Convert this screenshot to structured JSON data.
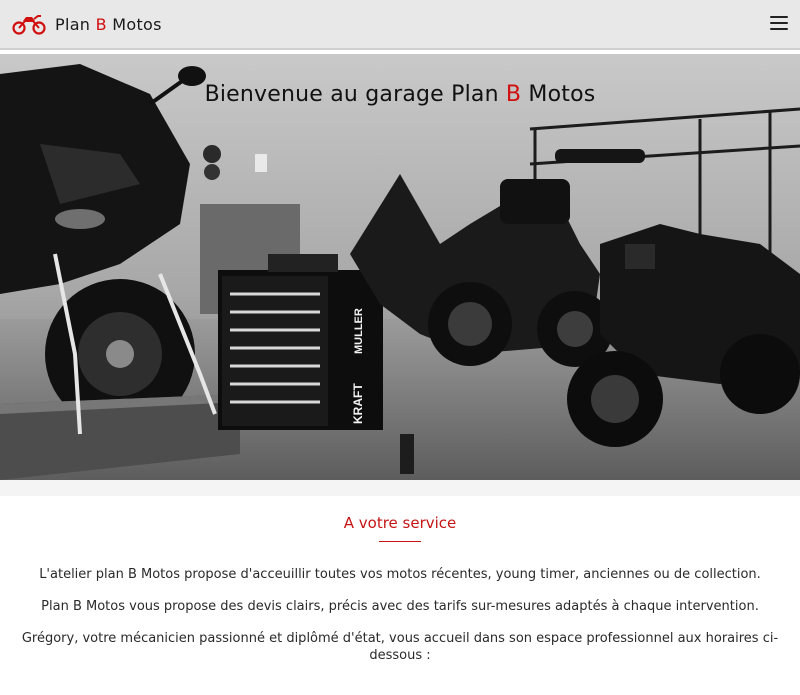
{
  "navbar": {
    "brand_prefix": "Plan ",
    "brand_accent": "B",
    "brand_suffix": " Motos",
    "logo_icon": "motorcycle-icon",
    "menu_icon": "hamburger-menu-icon"
  },
  "hero": {
    "title_prefix": "Bienvenue au garage Plan ",
    "title_accent": "B",
    "title_suffix": " Motos",
    "toolbox_brand_1": "KRAFT",
    "toolbox_brand_2": "MULLER"
  },
  "service": {
    "title": "A votre service",
    "paragraphs": [
      "L'atelier plan B Motos propose d'acceuillir toutes vos motos récentes, young timer, anciennes ou de collection.",
      "Plan B Motos vous propose des devis clairs, précis avec des tarifs sur-mesures adaptés à chaque intervention.",
      "Grégory, votre mécanicien passionné et diplômé d'état, vous accueil dans son espace professionnel aux horaires ci-dessous :"
    ]
  },
  "colors": {
    "accent": "#d10f0f",
    "navbar_bg": "#e8e8e8"
  }
}
